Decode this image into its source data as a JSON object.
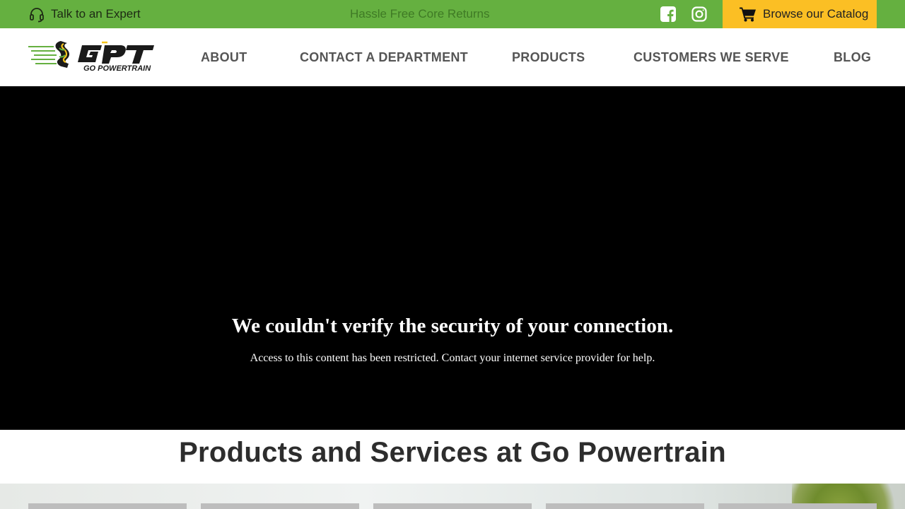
{
  "topbar": {
    "expert_label": "Talk to an Expert",
    "tagline": "Hassle Free Core Returns",
    "facebook_icon": "facebook-square-icon",
    "instagram_icon": "instagram-icon",
    "catalog_label": "Browse our Catalog",
    "colors": {
      "background": "#65b040",
      "catalog_bg": "#fbbf24"
    }
  },
  "nav": {
    "logo_text": "GO POWERTRAIN",
    "items": [
      {
        "label": "ABOUT"
      },
      {
        "label": "CONTACT A DEPARTMENT"
      },
      {
        "label": "PRODUCTS"
      },
      {
        "label": "CUSTOMERS WE SERVE"
      },
      {
        "label": "BLOG"
      }
    ]
  },
  "hero": {
    "title": "We couldn't verify the security of your connection.",
    "message": "Access to this content has been restricted. Contact your internet service provider for help."
  },
  "products": {
    "heading": "Products and Services at Go Powertrain"
  }
}
